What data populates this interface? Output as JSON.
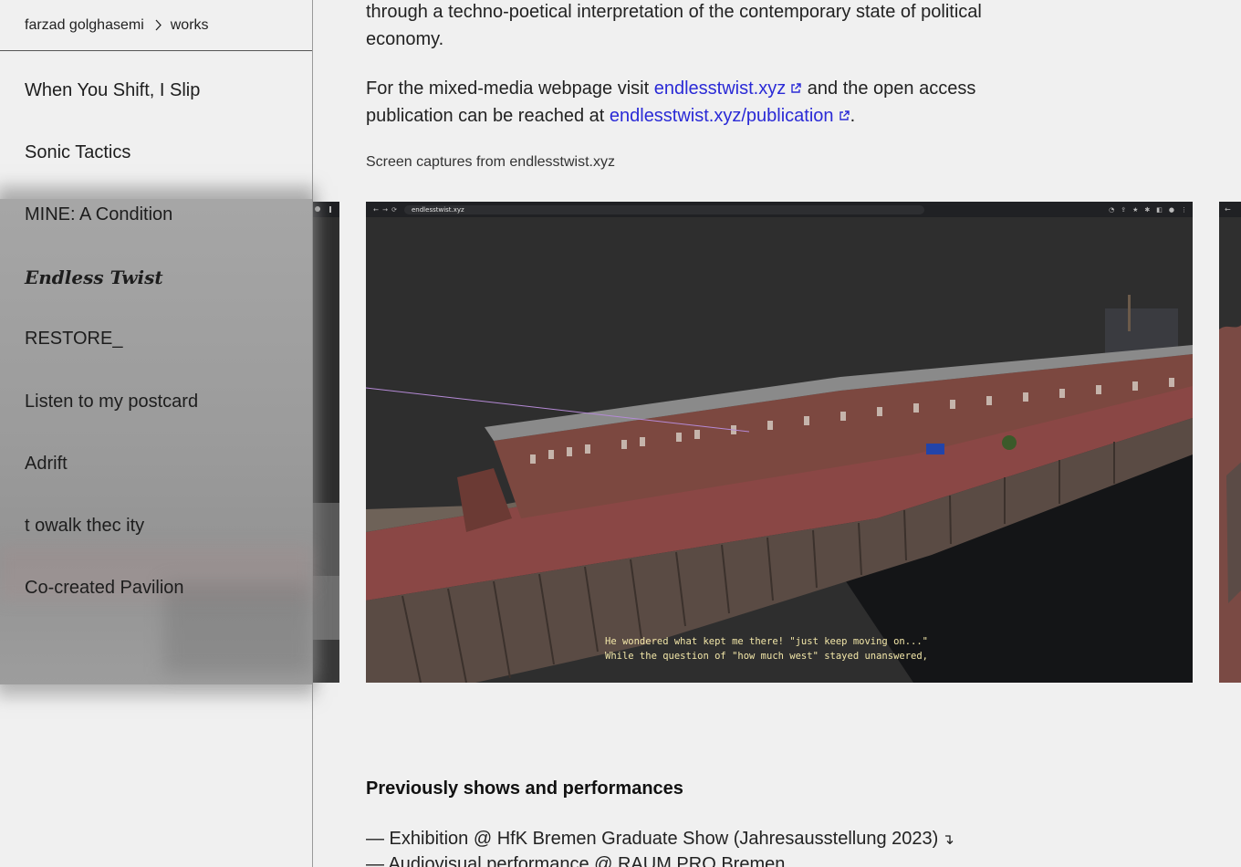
{
  "breadcrumb": {
    "root": "farzad golghasemi",
    "current": "works"
  },
  "sidebar": {
    "items": [
      {
        "label": "When You Shift, I Slip"
      },
      {
        "label": "Sonic Tactics"
      },
      {
        "label": "MINE: A Condition"
      },
      {
        "label": "Endless Twist"
      },
      {
        "label": "RESTORE_"
      },
      {
        "label": "Listen to my postcard"
      },
      {
        "label": "Adrift"
      },
      {
        "label": "t owalk thec ity"
      },
      {
        "label": "Co-created Pavilion"
      }
    ]
  },
  "main": {
    "intro": "through a techno-poetical interpretation of the contemporary state of political economy.",
    "links_para": {
      "prefix": "For the mixed-media webpage visit",
      "link1": "endlesstwist.xyz",
      "middle": "and the open access publication can be reached at",
      "link2": "endlesstwist.xyz/publication",
      "suffix": "."
    },
    "caption": "Screen captures from endlesstwist.xyz",
    "screenshot": {
      "url": "endlesstwist.xyz",
      "subtitle_line1": "He wondered what kept me there! \"just keep moving on...\"",
      "subtitle_line2": "While the question of \"how much west\" stayed unanswered,"
    },
    "shows_heading": "Previously shows and performances",
    "shows": [
      {
        "text": "— Exhibition @ HfK Bremen Graduate Show (Jahresausstellung 2023)",
        "arrow": "↴"
      },
      {
        "text": "— Audiovisual performance @ RAUM PRO Bremen"
      }
    ]
  },
  "colors": {
    "link": "#2a2ad6",
    "background": "#f0f0f0",
    "subtitle": "#f2e6a8"
  }
}
